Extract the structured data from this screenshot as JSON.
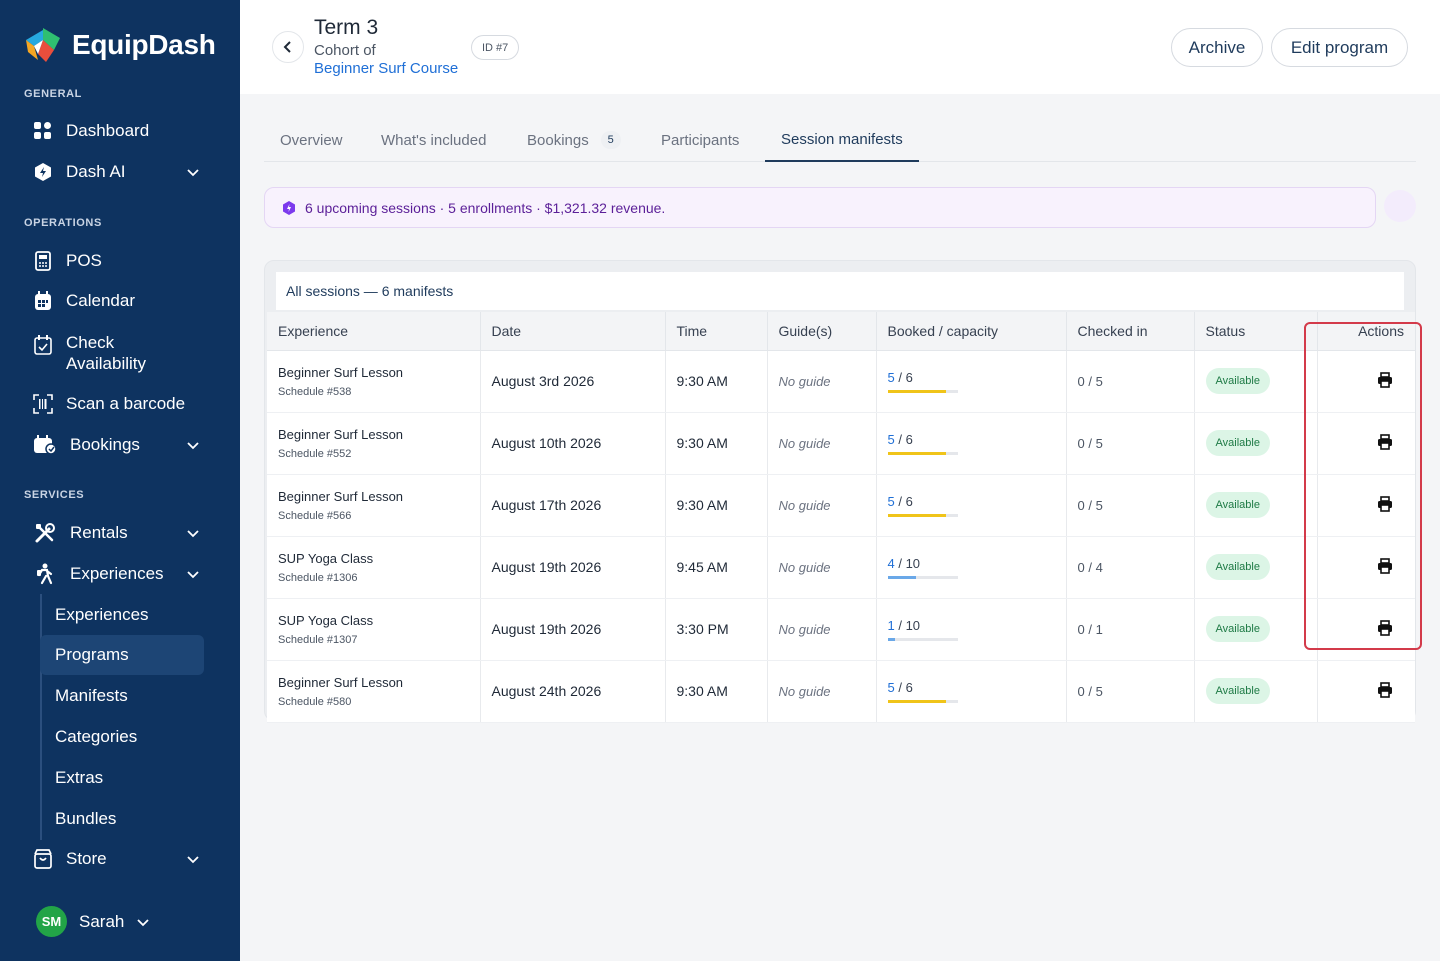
{
  "app": {
    "name": "EquipDash"
  },
  "sidebar": {
    "sections": {
      "general": "GENERAL",
      "operations": "OPERATIONS",
      "services": "SERVICES"
    },
    "items": {
      "dashboard": "Dashboard",
      "dash_ai": "Dash AI",
      "pos": "POS",
      "calendar": "Calendar",
      "check_availability_1": "Check",
      "check_availability_2": "Availability",
      "scan_barcode": "Scan a barcode",
      "bookings": "Bookings",
      "rentals": "Rentals",
      "experiences": "Experiences",
      "store": "Store"
    },
    "sub_items": {
      "experiences": "Experiences",
      "programs": "Programs",
      "manifests": "Manifests",
      "categories": "Categories",
      "extras": "Extras",
      "bundles": "Bundles"
    },
    "user": {
      "initials": "SM",
      "name": "Sarah"
    }
  },
  "header": {
    "title": "Term 3",
    "cohort_of": "Cohort of",
    "cohort_link": "Beginner Surf Course",
    "id_badge": "ID #7",
    "archive_label": "Archive",
    "edit_label": "Edit program"
  },
  "tabs": {
    "overview": "Overview",
    "whats_included": "What's included",
    "bookings": "Bookings",
    "bookings_count": "5",
    "participants": "Participants",
    "session_manifests": "Session manifests"
  },
  "banner": {
    "text": "6 upcoming sessions · 5 enrollments · $1,321.32 revenue."
  },
  "manifests": {
    "title": "All sessions — 6 manifests",
    "columns": {
      "experience": "Experience",
      "date": "Date",
      "time": "Time",
      "guides": "Guide(s)",
      "booked": "Booked / capacity",
      "checked_in": "Checked in",
      "status": "Status",
      "actions": "Actions"
    },
    "rows": [
      {
        "experience": "Beginner Surf Lesson",
        "schedule": "Schedule #538",
        "date": "August 3rd 2026",
        "time": "9:30 AM",
        "guide": "No guide",
        "booked": "5",
        "capacity": " / 6",
        "booked_n": 5,
        "capacity_n": 6,
        "bar_color": "#f0c419",
        "checked": "0 / 5",
        "status": "Available"
      },
      {
        "experience": "Beginner Surf Lesson",
        "schedule": "Schedule #552",
        "date": "August 10th 2026",
        "time": "9:30 AM",
        "guide": "No guide",
        "booked": "5",
        "capacity": " / 6",
        "booked_n": 5,
        "capacity_n": 6,
        "bar_color": "#f0c419",
        "checked": "0 / 5",
        "status": "Available"
      },
      {
        "experience": "Beginner Surf Lesson",
        "schedule": "Schedule #566",
        "date": "August 17th 2026",
        "time": "9:30 AM",
        "guide": "No guide",
        "booked": "5",
        "capacity": " / 6",
        "booked_n": 5,
        "capacity_n": 6,
        "bar_color": "#f0c419",
        "checked": "0 / 5",
        "status": "Available"
      },
      {
        "experience": "SUP Yoga Class",
        "schedule": "Schedule #1306",
        "date": "August 19th 2026",
        "time": "9:45 AM",
        "guide": "No guide",
        "booked": "4",
        "capacity": " / 10",
        "booked_n": 4,
        "capacity_n": 10,
        "bar_color": "#6aa8e8",
        "checked": "0 / 4",
        "status": "Available"
      },
      {
        "experience": "SUP Yoga Class",
        "schedule": "Schedule #1307",
        "date": "August 19th 2026",
        "time": "3:30 PM",
        "guide": "No guide",
        "booked": "1",
        "capacity": " / 10",
        "booked_n": 1,
        "capacity_n": 10,
        "bar_color": "#6aa8e8",
        "checked": "0 / 1",
        "status": "Available"
      },
      {
        "experience": "Beginner Surf Lesson",
        "schedule": "Schedule #580",
        "date": "August 24th 2026",
        "time": "9:30 AM",
        "guide": "No guide",
        "booked": "5",
        "capacity": " / 6",
        "booked_n": 5,
        "capacity_n": 6,
        "bar_color": "#f0c419",
        "checked": "0 / 5",
        "status": "Available"
      }
    ]
  },
  "colors": {
    "sidebar_bg": "#0e3360",
    "accent_link": "#1f6fd6",
    "status_green": "#1e7a45",
    "banner_purple": "#5b1f98",
    "highlight_red": "#d33a4a"
  }
}
